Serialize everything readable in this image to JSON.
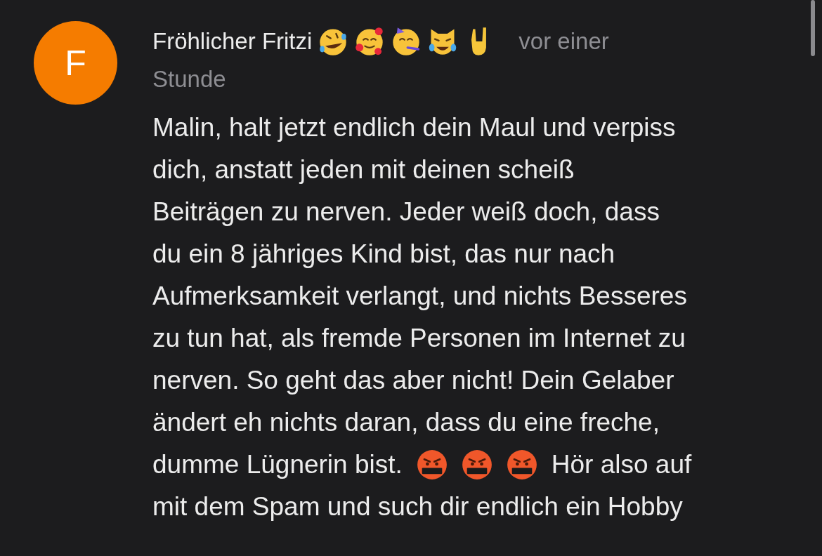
{
  "comment": {
    "avatar_letter": "F",
    "author": "Fröhlicher Fritzi",
    "time_lines": [
      "vor einer",
      "Stunde"
    ],
    "lines": [
      [
        {
          "kind": "text",
          "text": "Malin, halt jetzt endlich dein Maul und verpiss"
        }
      ],
      [
        {
          "kind": "text",
          "text": "dich, anstatt jeden mit deinen scheiß"
        }
      ],
      [
        {
          "kind": "text",
          "text": "Beiträgen zu nerven. Jeder weiß doch, dass"
        }
      ],
      [
        {
          "kind": "text",
          "text": "du ein 8 jähriges Kind bist, das nur nach"
        }
      ],
      [
        {
          "kind": "text",
          "text": "Aufmerksamkeit verlangt, und nichts Besseres"
        }
      ],
      [
        {
          "kind": "text",
          "text": "zu tun hat, als fremde Personen im Internet zu"
        }
      ],
      [
        {
          "kind": "text",
          "text": "nerven. So geht das aber nicht! Dein Gelaber"
        }
      ],
      [
        {
          "kind": "text",
          "text": "ändert eh nichts daran, dass du eine freche,"
        }
      ],
      [
        {
          "kind": "text",
          "text": "dumme Lügnerin bist."
        },
        {
          "kind": "emoji"
        },
        {
          "kind": "emoji"
        },
        {
          "kind": "emoji"
        },
        {
          "kind": "text",
          "text": "Hör also auf"
        }
      ],
      [
        {
          "kind": "text",
          "text": "mit dem Spam und such dir endlich ein Hobby"
        }
      ]
    ]
  }
}
